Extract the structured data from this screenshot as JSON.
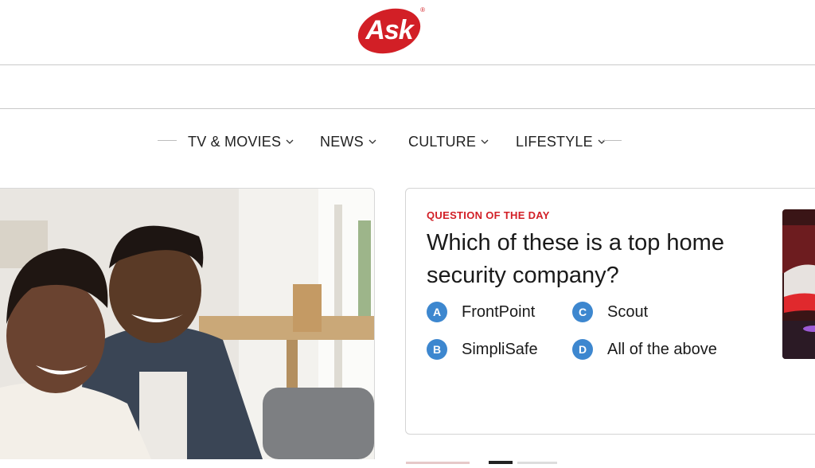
{
  "brand": {
    "logo_text": "Ask",
    "registered": "®",
    "color": "#d21f26"
  },
  "nav": {
    "items": [
      {
        "label": "TV & MOVIES",
        "icon": "chevron-down-icon"
      },
      {
        "label": "NEWS",
        "icon": "chevron-down-icon"
      },
      {
        "label": "CULTURE",
        "icon": "chevron-down-icon"
      },
      {
        "label": "LIFESTYLE",
        "icon": "chevron-down-icon"
      }
    ]
  },
  "question": {
    "eyebrow": "QUESTION OF THE DAY",
    "text": "Which of these is a top home security company?",
    "accent_color": "#3d87cf",
    "answers": [
      {
        "letter": "A",
        "label": "FrontPoint"
      },
      {
        "letter": "B",
        "label": "SimpliSafe"
      },
      {
        "letter": "C",
        "label": "Scout"
      },
      {
        "letter": "D",
        "label": "All of the above"
      }
    ]
  }
}
